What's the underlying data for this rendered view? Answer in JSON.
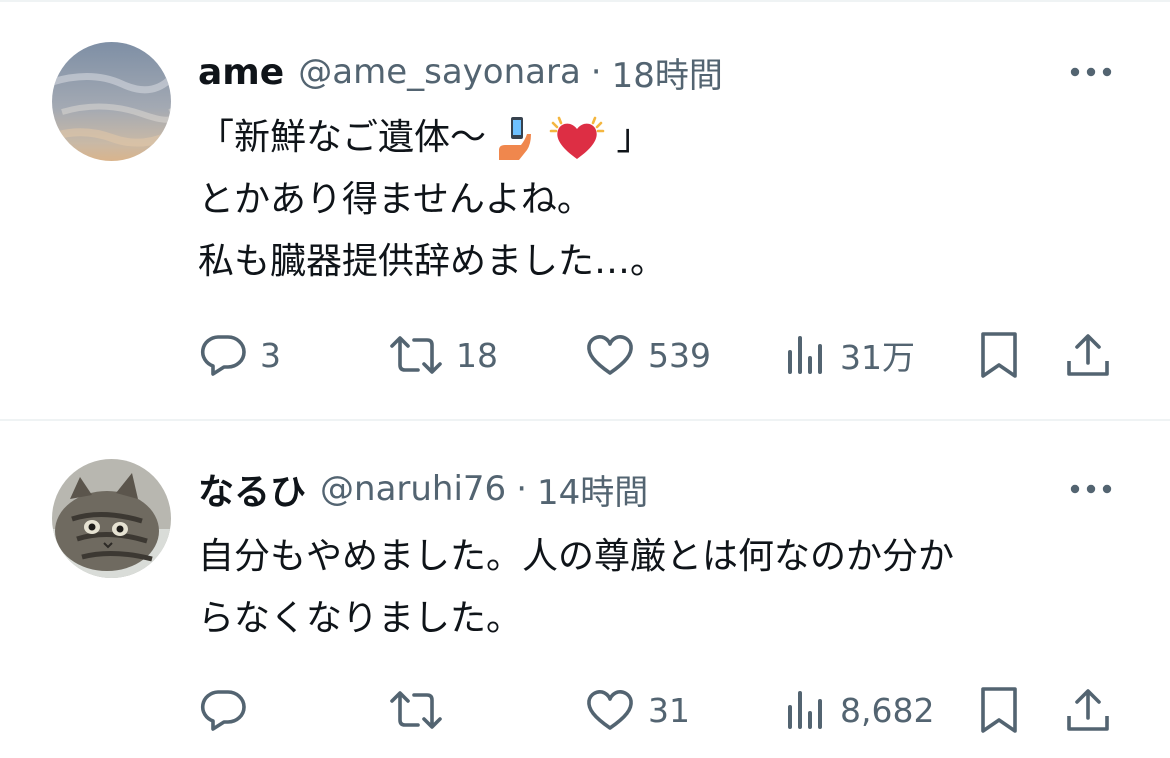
{
  "tweets": [
    {
      "author": {
        "name": "ame",
        "handle": "@ame_sayonara",
        "separator": "·",
        "time": "18時間"
      },
      "body": {
        "line1_prefix": "「新鮮なご遺体〜",
        "line1_suffix": "」",
        "line2": "とかあり得ませんよね。",
        "line3": "私も臓器提供辞めました…。",
        "emojis": [
          "selfie-phone-emoji",
          "beating-heart-emoji"
        ]
      },
      "actions": {
        "replies": "3",
        "retweets": "18",
        "likes": "539",
        "views": "31万"
      }
    },
    {
      "author": {
        "name": "なるひ",
        "handle": "@naruhi76",
        "separator": "·",
        "time": "14時間"
      },
      "body": {
        "line1": "自分もやめました。人の尊厳とは何なのか分か",
        "line2": "らなくなりました。"
      },
      "actions": {
        "replies": "",
        "retweets": "",
        "likes": "31",
        "views": "8,682"
      }
    }
  ],
  "icons": [
    "more-icon",
    "reply-icon",
    "retweet-icon",
    "like-icon",
    "views-icon",
    "bookmark-icon",
    "share-icon"
  ],
  "colors": {
    "text": "#0f1419",
    "secondary": "#536471",
    "divider": "#eff3f4"
  }
}
